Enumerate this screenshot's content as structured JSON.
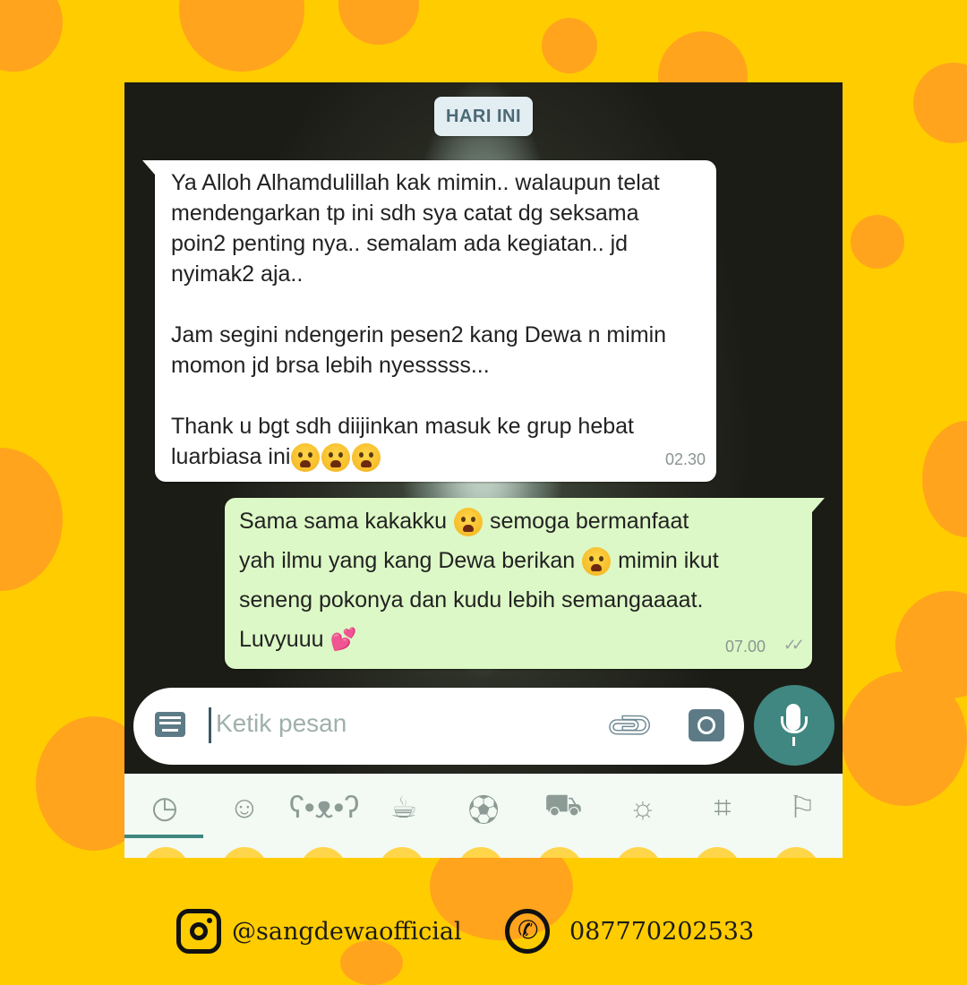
{
  "chat": {
    "date_chip": "HARI INI",
    "incoming": {
      "text": "Ya Alloh Alhamdulillah kak mimin.. walaupun telat\nmendengarkan tp ini sdh sya catat dg seksama\npoin2 penting nya.. semalam ada kegiatan.. jd\nnyimak2 aja..\n\nJam segini ndengerin pesen2 kang Dewa n mimin\nmomon jd brsa lebih nyesssss...\n\nThank u bgt sdh diijinkan masuk ke grup hebat\nluarbiasa ini",
      "emoji": "😭😭😭",
      "time": "02.30"
    },
    "outgoing": {
      "line1": "Sama sama kakakku",
      "line1b": "semoga bermanfaat",
      "line2": "yah ilmu yang kang Dewa berikan",
      "line2b": "mimin ikut",
      "line3": "seneng pokonya dan kudu lebih semangaaaat.",
      "line4": "Luvyuuu",
      "heart": "💕",
      "time": "07.00",
      "status_icon": "double-check-icon"
    }
  },
  "composer": {
    "placeholder": "Ketik pesan",
    "icons": [
      "keyboard-icon",
      "attach-icon",
      "camera-icon",
      "mic-icon"
    ]
  },
  "emoji_tabs": [
    "recent",
    "smileys",
    "animals",
    "food",
    "activity",
    "travel",
    "objects",
    "symbols",
    "flags"
  ],
  "footer": {
    "instagram": "@sangdewaofficial",
    "whatsapp": "087770202533"
  },
  "colors": {
    "background": "#FFCC00",
    "dots": "#FFA41C",
    "outgoing_bubble": "#DCF8C6",
    "accent": "#3F8780"
  }
}
